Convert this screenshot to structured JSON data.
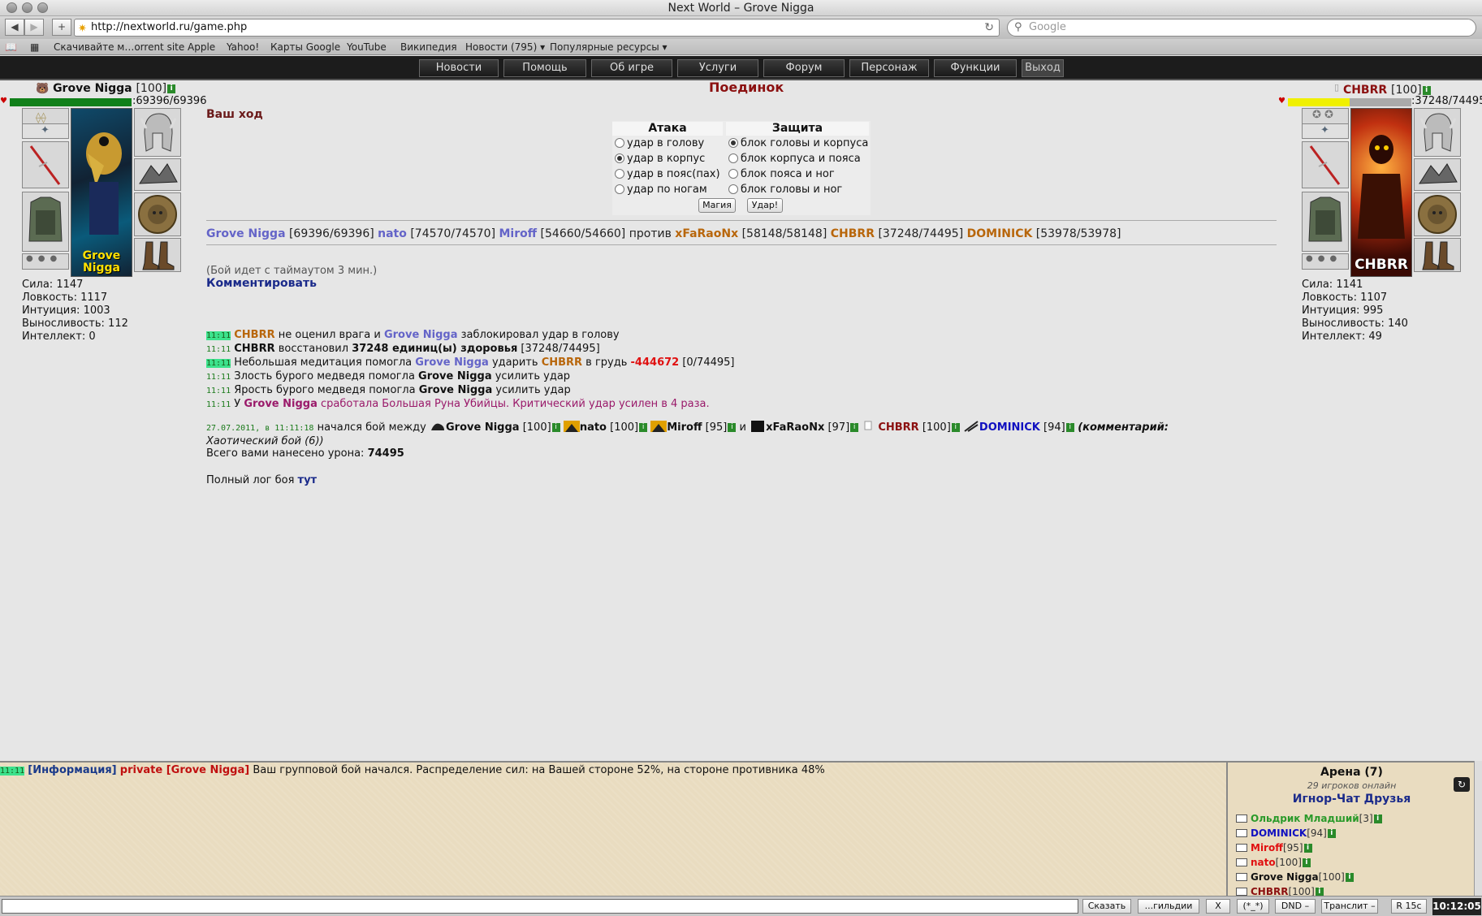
{
  "browser": {
    "title": "Next World – Grove Nigga",
    "url": "http://nextworld.ru/game.php",
    "search_placeholder": "Google",
    "bookmarks": [
      "Скачивайте м…orrent site",
      "Apple",
      "Yahoo!",
      "Карты Google",
      "YouTube",
      "Википедия",
      "Новости (795) ▾",
      "Популярные ресурсы ▾"
    ]
  },
  "menu": [
    "Новости",
    "Помощь",
    "Об игре",
    "Услуги",
    "Форум",
    "Персонаж",
    "Функции",
    "Выход"
  ],
  "left_player": {
    "name": "Grove Nigga",
    "level": "[100]",
    "hp_text": ":69396/69396",
    "hp_fraction": 1.0,
    "avatar_caption": "Grove Nigga",
    "stats": [
      "Сила: 1147",
      "Ловкость: 1117",
      "Интуиция: 1003",
      "Выносливость: 112",
      "Интеллект: 0"
    ]
  },
  "right_player": {
    "name": "CHBRR",
    "level": "[100]",
    "hp_text": ":37248/74495",
    "hp_fraction": 0.5,
    "avatar_caption": "CHBRR",
    "stats": [
      "Сила: 1141",
      "Ловкость: 1107",
      "Интуиция: 995",
      "Выносливость: 140",
      "Интеллект: 49"
    ]
  },
  "fight": {
    "title": "Поединок",
    "turn": "Ваш ход",
    "attack_header": "Атака",
    "defense_header": "Защита",
    "attack_options": [
      "удар в голову",
      "удар в корпус",
      "удар в пояс(пах)",
      "удар по ногам"
    ],
    "attack_selected": 1,
    "defense_options": [
      "блок головы и корпуса",
      "блок корпуса и пояса",
      "блок пояса и ног",
      "блок головы и ног"
    ],
    "defense_selected": 0,
    "magic_button": "Магия",
    "hit_button": "Удар!",
    "teams": {
      "ours": [
        {
          "name": "Grove Nigga",
          "hp": "[69396/69396]"
        },
        {
          "name": "nato",
          "hp": "[74570/74570]"
        },
        {
          "name": "Miroff",
          "hp": "[54660/54660]"
        }
      ],
      "versus": "против",
      "theirs": [
        {
          "name": "xFaRaoNx",
          "hp": "[58148/58148]"
        },
        {
          "name": "CHBRR",
          "hp": "[37248/74495]"
        },
        {
          "name": "DOMINICK",
          "hp": "[53978/53978]"
        }
      ]
    },
    "timeout": "(Бой идет с таймаутом 3 мин.)",
    "comment_link": "Комментировать"
  },
  "log": [
    {
      "time": "11:11",
      "hl": true,
      "parts": [
        [
          "CHBRR",
          "orange"
        ],
        [
          " не оценил врага и ",
          ""
        ],
        [
          "Grove Nigga",
          "blue"
        ],
        [
          " заблокировал удар в голову",
          ""
        ]
      ]
    },
    {
      "time": "11:11",
      "hl": false,
      "parts": [
        [
          "CHBRR",
          "blk"
        ],
        [
          " восстановил ",
          ""
        ],
        [
          "37248 единиц(ы) здоровья",
          "blk"
        ],
        [
          " [37248/74495]",
          ""
        ]
      ]
    },
    {
      "time": "11:11",
      "hl": true,
      "parts": [
        [
          "Небольшая медитация помогла ",
          ""
        ],
        [
          "Grove Nigga",
          "blue"
        ],
        [
          " ударить ",
          ""
        ],
        [
          "CHBRR",
          "orange"
        ],
        [
          " в грудь ",
          ""
        ],
        [
          "-444672",
          "red"
        ],
        [
          " [0/74495]",
          ""
        ]
      ]
    },
    {
      "time": "11:11",
      "hl": false,
      "parts": [
        [
          "Злость бурого медведя помогла ",
          ""
        ],
        [
          "Grove Nigga",
          "blk"
        ],
        [
          " усилить удар",
          ""
        ]
      ]
    },
    {
      "time": "11:11",
      "hl": false,
      "parts": [
        [
          "Ярость бурого медведя помогла ",
          ""
        ],
        [
          "Grove Nigga",
          "blk"
        ],
        [
          " усилить удар",
          ""
        ]
      ]
    },
    {
      "time": "11:11",
      "hl": false,
      "parts": [
        [
          "У ",
          ""
        ],
        [
          "Grove Nigga",
          "purple-b"
        ],
        [
          " сработала Большая Руна Убийцы. Критический удар усилен в 4 раза.",
          "purple"
        ]
      ]
    }
  ],
  "fight_info": {
    "date": "27.07.2011, в 11:11:18",
    "started": " начался бой между ",
    "p1": "Grove Nigga",
    "p1_lvl": "[100]",
    "p2": "nato",
    "p2_lvl": "[100]",
    "p3": "Miroff",
    "p3_lvl": "[95]",
    "and": " и ",
    "p4": "xFaRaoNx",
    "p4_lvl": "[97]",
    "p5": "CHBRR",
    "p5_lvl": "[100]",
    "p6": "DOMINICK",
    "p6_lvl": "[94]",
    "comment_open": " (комментарий:",
    "comment_body": "Хаотический бой (6))",
    "total_label": "Всего вами нанесено урона: ",
    "total_value": "74495",
    "fulllog_label": "Полный лог боя ",
    "fulllog_link": "тут"
  },
  "chat": {
    "time": "11:11",
    "tag": "[Информация]",
    "private": "private [Grove Nigga]",
    "message": " Ваш групповой бой начался. Распределение сил: на Вашей стороне 52%, на стороне противника 48%"
  },
  "sidebar": {
    "room": "Арена (7)",
    "online": "29 игроков онлайн",
    "tabs": "Игнор-Чат Друзья",
    "players": [
      {
        "name": "Ольдрик Младший",
        "lvl": "[3]",
        "color": "#2a9a2a"
      },
      {
        "name": "DOMINICK",
        "lvl": "[94]",
        "color": "#1010c0"
      },
      {
        "name": "Miroff",
        "lvl": "[95]",
        "color": "#e01010"
      },
      {
        "name": "nato",
        "lvl": "[100]",
        "color": "#e01010"
      },
      {
        "name": "Grove Nigga",
        "lvl": "[100]",
        "color": "#111111"
      },
      {
        "name": "CHBRR",
        "lvl": "[100]",
        "color": "#8b1010"
      }
    ]
  },
  "statusbar": {
    "say": "Сказать",
    "guild": "...гильдии",
    "x": "X",
    "smile": "(*_*)",
    "dnd": "DND –",
    "translit": "Транслит –",
    "refresh": "R 15c",
    "clock": "10:12:05"
  }
}
